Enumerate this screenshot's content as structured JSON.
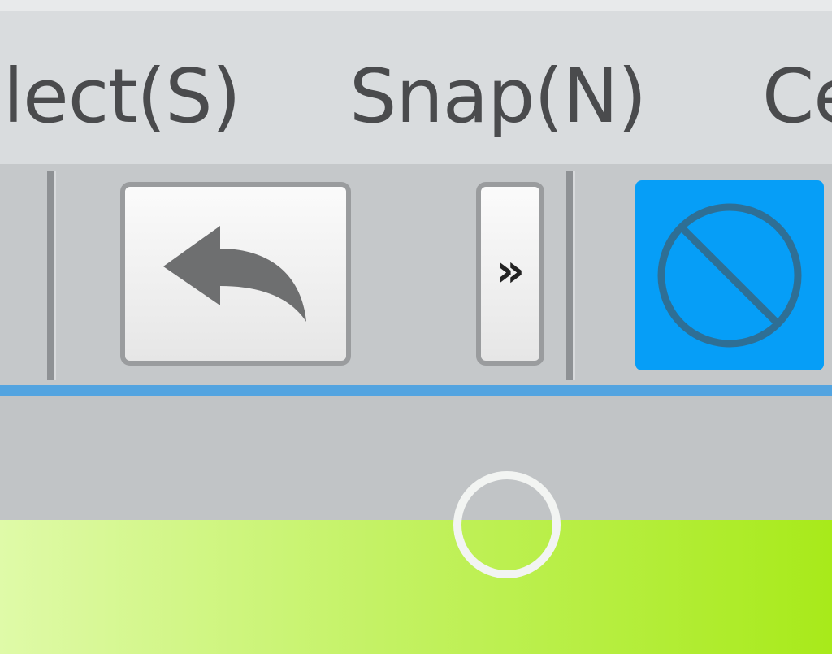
{
  "menubar": {
    "items": [
      {
        "label": "elect(S)"
      },
      {
        "label": "Snap(N)"
      },
      {
        "label": "Ce"
      }
    ]
  },
  "toolbar": {
    "buttons": [
      {
        "icon": "undo-arrow-icon"
      },
      {
        "label": "»",
        "icon": "more-chevrons-icon"
      },
      {
        "icon": "no-snap-icon",
        "active": true
      }
    ]
  },
  "colors": {
    "active_button": "#069ef7",
    "accent_line": "#53a4e0",
    "canvas_green": "#a8ea1a"
  }
}
